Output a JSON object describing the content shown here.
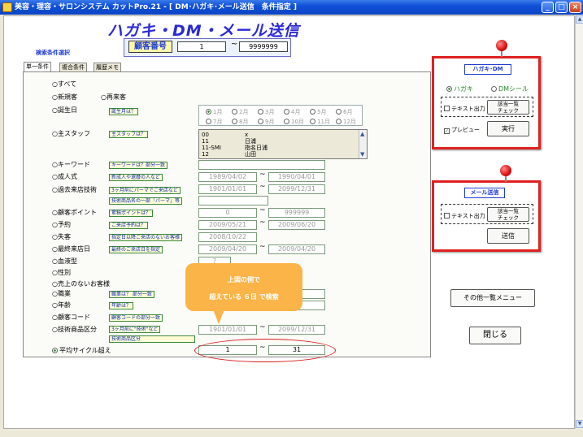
{
  "window": {
    "title": "美容・理容・サロンシステム カットPro.21 - [ DM･ハガキ･メール送信　条件指定 ]",
    "min": "_",
    "max": "□",
    "close": "×"
  },
  "header": {
    "app_title": "ハガキ・DM・メール送信",
    "customer_label": "顧客番号",
    "from": "1",
    "tilde": "~",
    "to": "9999999"
  },
  "search_select_label": "検索条件選択",
  "tabs": [
    {
      "label": "単一条件"
    },
    {
      "label": "複合条件"
    },
    {
      "label": "履歴メモ"
    }
  ],
  "tilde": "~",
  "conditions": {
    "all": "○すべて",
    "new": "○新規客",
    "repeat": "○再来客",
    "birthday": "○誕生日",
    "birthday_tag": "誕生月は？",
    "months": [
      "1月",
      "2月",
      "3月",
      "4月",
      "5月",
      "6月",
      "7月",
      "8月",
      "9月",
      "10月",
      "11月",
      "12月"
    ],
    "staff": "○主スタッフ",
    "staff_tag": "主スタッフは？",
    "staff_list": [
      [
        "00",
        "x"
      ],
      [
        "11",
        "日浦"
      ],
      [
        "11-SMI",
        "指名日浦"
      ],
      [
        "12",
        "山田"
      ]
    ],
    "keyword": "○キーワード",
    "keyword_tag": "キーワードは？部分一致",
    "adult": "○成人式",
    "adult_tag": "新成人や還暦の人など",
    "adult_from": "1989/04/02",
    "adult_to": "1990/04/01",
    "past_tech": "○過去来店技術",
    "past_tech_tag": "3ヶ月前にパーマでご来店など",
    "past_from": "1901/01/01",
    "past_to": "2099/12/31",
    "tech_name_tag": "技術商品名の一部「パーマ」等",
    "points": "○顧客ポイント",
    "points_tag": "累積ポイントは？",
    "points_from": "0",
    "points_to": "999999",
    "reserve": "○予約",
    "reserve_tag": "ご来店予約は？",
    "reserve_from": "2009/05/21",
    "reserve_to": "2009/06/20",
    "lost": "○失客",
    "lost_tag": "指定日以降ご来店のないお客様",
    "lost_date": "2008/10/22",
    "last_visit": "○最終来店日",
    "last_tag": "最終のご来店日を指定",
    "last_from": "2009/04/20",
    "last_to": "2009/04/20",
    "blood": "○血液型",
    "blood_value": "?",
    "gender": "○性別",
    "no_sales": "○売上のないお客様",
    "job": "○職業",
    "job_tag": "職業は？ 部分一致",
    "age": "○年齢",
    "age_tag": "年齢は？",
    "code": "○顧客コード",
    "code_tag": "顧客コードの部分一致",
    "tech_cat": "○技術商品区分",
    "tech_cat_tag": "3ヶ月前に\"技術\"など",
    "tech_cat_from": "1901/01/01",
    "tech_cat_to": "2099/12/31",
    "tech_cat_tag2": "技術商品区分",
    "cycle": "平均サイクル超え",
    "cycle_from": "1",
    "cycle_to": "31"
  },
  "callout": {
    "line1": "上図の例で",
    "line2": "超えている ６日 で検索"
  },
  "postcard_panel": {
    "title": "ハガキ･DM",
    "opt_postcard": "ハガキ",
    "opt_dm": "DMシール",
    "text_out": "テキスト出力",
    "check_btn": "該当一覧\nチェック",
    "preview": "プレビュー",
    "run": "実行"
  },
  "mail_panel": {
    "title": "メール送信",
    "text_out": "テキスト出力",
    "check_btn": "該当一覧\nチェック",
    "send": "送信"
  },
  "other_menu": "その他一覧メニュー",
  "close_btn": "閉じる"
}
